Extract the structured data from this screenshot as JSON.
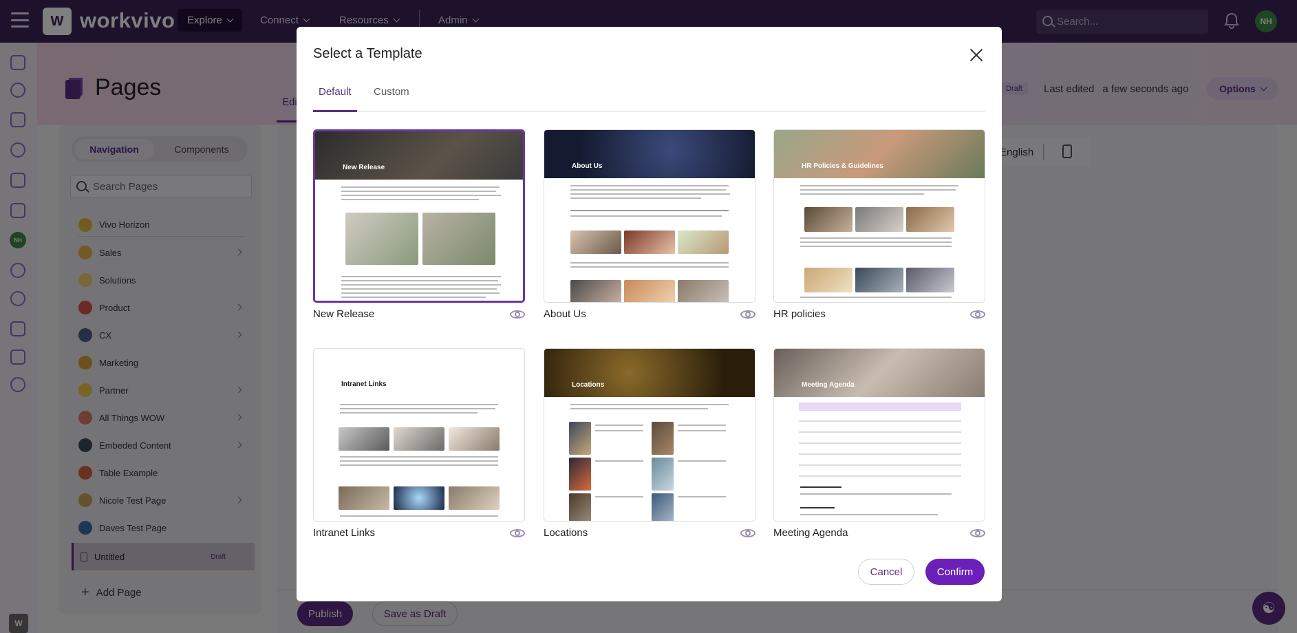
{
  "topbar": {
    "logo_text": "workvivo",
    "nav": [
      "Explore",
      "Connect",
      "Resources",
      "Admin"
    ],
    "search_placeholder": "Search...",
    "avatar_initials": "NH"
  },
  "page": {
    "title": "Pages",
    "edit_tab": "Edi",
    "draft_badge": "Draft",
    "last_edited_label": "Last edited",
    "last_edited_value": "a few seconds ago",
    "options_label": "Options",
    "language": "English",
    "publish_label": "Publish",
    "save_draft_label": "Save as Draft"
  },
  "rail": {
    "avatar_initials": "NH"
  },
  "left_panel": {
    "tabs": [
      "Navigation",
      "Components"
    ],
    "search_placeholder": "Search Pages",
    "items": [
      {
        "label": "Vivo Horizon",
        "color": "#e2b93b",
        "has_children": false
      },
      {
        "label": "Sales",
        "color": "#e9b04a",
        "has_children": true
      },
      {
        "label": "Solutions",
        "color": "#f0d070",
        "has_children": false
      },
      {
        "label": "Product",
        "color": "#d9534f",
        "has_children": true
      },
      {
        "label": "CX",
        "color": "#4a5f8a",
        "has_children": true
      },
      {
        "label": "Marketing",
        "color": "#d4a23a",
        "has_children": false
      },
      {
        "label": "Partner",
        "color": "#f2c94c",
        "has_children": true
      },
      {
        "label": "All Things WOW",
        "color": "#e07b6a",
        "has_children": true
      },
      {
        "label": "Embeded Content",
        "color": "#3b4a5a",
        "has_children": true
      },
      {
        "label": "Table Example",
        "color": "#d0643a",
        "has_children": false
      },
      {
        "label": "Nicole Test Page",
        "color": "#c9a25a",
        "has_children": true
      },
      {
        "label": "Daves Test Page",
        "color": "#3a6fb0",
        "has_children": false
      }
    ],
    "selected": {
      "label": "Untitled",
      "badge": "Draft"
    },
    "add_page_label": "Add Page"
  },
  "modal": {
    "title": "Select a Template",
    "tabs": [
      "Default",
      "Custom"
    ],
    "templates": [
      {
        "name": "New Release",
        "banner_text": "New Release",
        "banner_color": "#3b3a3a",
        "selected": true
      },
      {
        "name": "About Us",
        "banner_text": "About Us",
        "banner_color": "#1e2a4a",
        "selected": false
      },
      {
        "name": "HR policies",
        "banner_text": "HR Policies & Guidelines",
        "banner_color": "#7a8a6a",
        "selected": false
      },
      {
        "name": "Intranet Links",
        "banner_text": "Intranet Links",
        "banner_color": "#ffffff",
        "selected": false
      },
      {
        "name": "Locations",
        "banner_text": "Locations",
        "banner_color": "#4a3a1a",
        "selected": false
      },
      {
        "name": "Meeting Agenda",
        "banner_text": "Meeting Agenda",
        "banner_color": "#9a8f86",
        "selected": false
      }
    ],
    "cancel_label": "Cancel",
    "confirm_label": "Confirm"
  }
}
